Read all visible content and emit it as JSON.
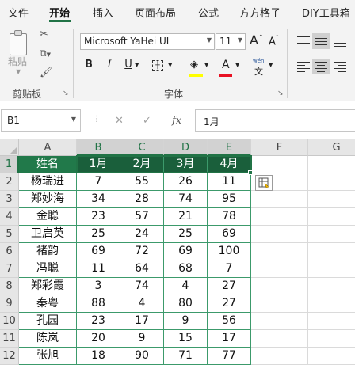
{
  "ribbon": {
    "tabs": [
      {
        "label": "文件"
      },
      {
        "label": "开始"
      },
      {
        "label": "插入"
      },
      {
        "label": "页面布局"
      },
      {
        "label": "公式"
      },
      {
        "label": "方方格子"
      },
      {
        "label": "DIY工具箱"
      }
    ],
    "clipboard": {
      "paste_label": "粘贴",
      "group_label": "剪贴板"
    },
    "font": {
      "name": "Microsoft YaHei UI",
      "size": "11",
      "bold": "B",
      "italic": "I",
      "underline": "U",
      "grow": "A",
      "shrink": "A",
      "font_color_glyph": "A",
      "phonetic_top": "wén",
      "phonetic_bottom": "文",
      "group_label": "字体",
      "highlight_color": "#ffff00",
      "font_color": "#e81123"
    }
  },
  "formula_bar": {
    "name_box": "B1",
    "formula": "1月"
  },
  "sheet": {
    "columns": [
      "A",
      "B",
      "C",
      "D",
      "E",
      "F",
      "G"
    ],
    "rows": [
      "1",
      "2",
      "3",
      "4",
      "5",
      "6",
      "7",
      "8",
      "9",
      "10",
      "11",
      "12"
    ],
    "header": [
      "姓名",
      "1月",
      "2月",
      "3月",
      "4月"
    ],
    "data": [
      [
        "杨瑞进",
        "7",
        "55",
        "26",
        "11"
      ],
      [
        "郑妙海",
        "34",
        "28",
        "74",
        "95"
      ],
      [
        "金聪",
        "23",
        "57",
        "21",
        "78"
      ],
      [
        "卫启英",
        "25",
        "24",
        "25",
        "69"
      ],
      [
        "褚韵",
        "69",
        "72",
        "69",
        "100"
      ],
      [
        "冯聪",
        "11",
        "64",
        "68",
        "7"
      ],
      [
        "郑彩霞",
        "3",
        "74",
        "4",
        "27"
      ],
      [
        "秦粤",
        "88",
        "4",
        "80",
        "27"
      ],
      [
        "孔园",
        "23",
        "17",
        "9",
        "56"
      ],
      [
        "陈岚",
        "20",
        "9",
        "15",
        "17"
      ],
      [
        "张旭",
        "18",
        "90",
        "71",
        "77"
      ]
    ],
    "accent_color": "#217346",
    "table_header_color": "#21794a"
  }
}
